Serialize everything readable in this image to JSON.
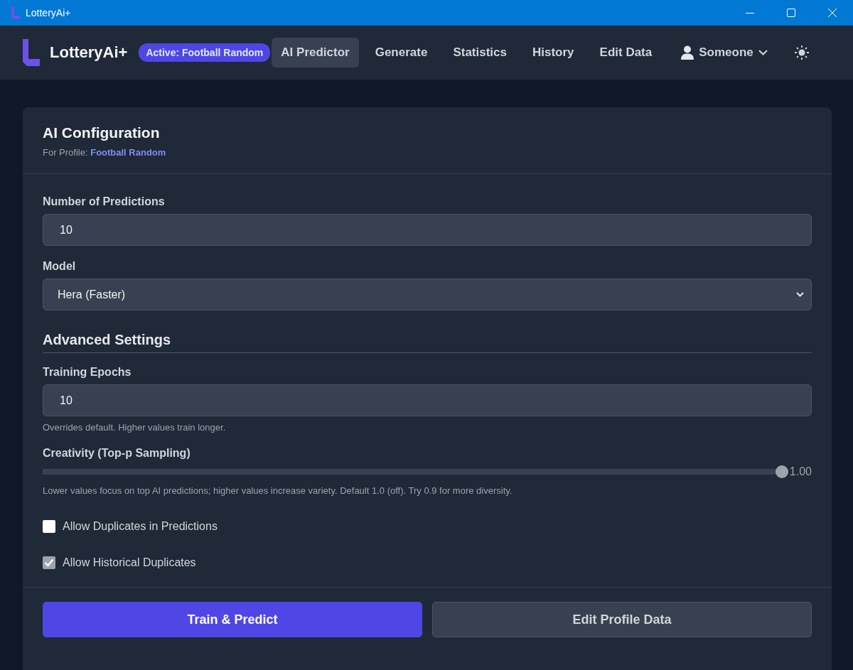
{
  "window": {
    "title": "LotteryAi+"
  },
  "nav": {
    "brand": "LotteryAi+",
    "active_badge": "Active: Football Random",
    "user": "Someone",
    "items": [
      {
        "label": "AI Predictor",
        "selected": true
      },
      {
        "label": "Generate",
        "selected": false
      },
      {
        "label": "Statistics",
        "selected": false
      },
      {
        "label": "History",
        "selected": false
      },
      {
        "label": "Edit Data",
        "selected": false
      }
    ]
  },
  "card": {
    "title": "AI Configuration",
    "subtitle": "For Profile: **Football Random**",
    "fields": [
      {
        "kind": "text",
        "label": "Number of Predictions",
        "value": "10"
      },
      {
        "kind": "select",
        "label": "Model",
        "value": "Hera (Faster)"
      }
    ],
    "advanced": {
      "heading": "Advanced Settings",
      "epochs": {
        "label": "Training Epochs",
        "value": "10",
        "help": "Overrides default. Higher values train longer."
      },
      "creativity": {
        "label": "Creativity (Top-p Sampling)",
        "level": 1.0,
        "reading": "1.00",
        "help": "Lower values focus on top AI predictions; higher values increase variety. Default 1.0 (off). Try 0.9 for more diversity."
      },
      "checkboxes": [
        {
          "label": "Allow Duplicates in Predictions",
          "checked": false
        },
        {
          "label": "Allow Historical Duplicates",
          "checked": true
        }
      ]
    },
    "buttons": [
      {
        "label": "Train & Predict",
        "kind": "primary"
      },
      {
        "label": "Edit Profile Data",
        "kind": "secondary"
      }
    ]
  }
}
